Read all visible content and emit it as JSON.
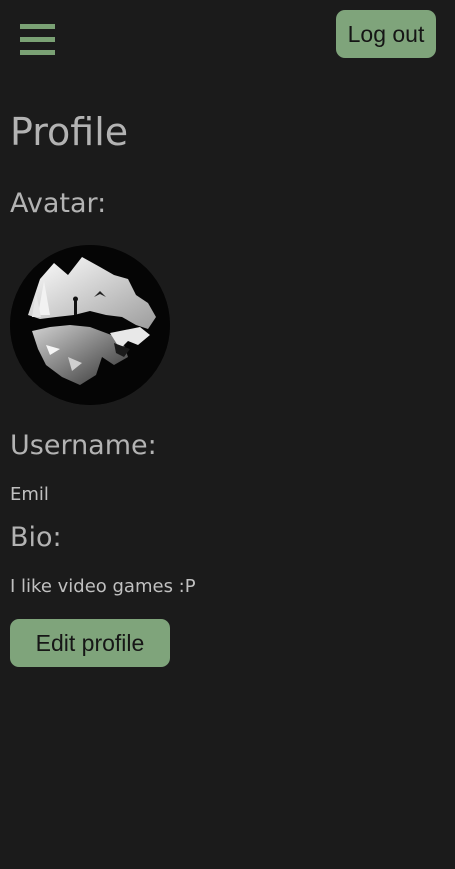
{
  "header": {
    "menu_icon": "hamburger-menu-icon",
    "logout_label": "Log out"
  },
  "profile": {
    "title": "Profile",
    "avatar_heading": "Avatar:",
    "avatar_image": "wolf-avatar-image",
    "username_heading": "Username:",
    "username": "Emil",
    "bio_heading": "Bio:",
    "bio": "I like video games :P",
    "edit_label": "Edit profile"
  },
  "colors": {
    "background": "#1b1b1b",
    "accent": "#7fa47b",
    "text": "#b3b3b3"
  }
}
